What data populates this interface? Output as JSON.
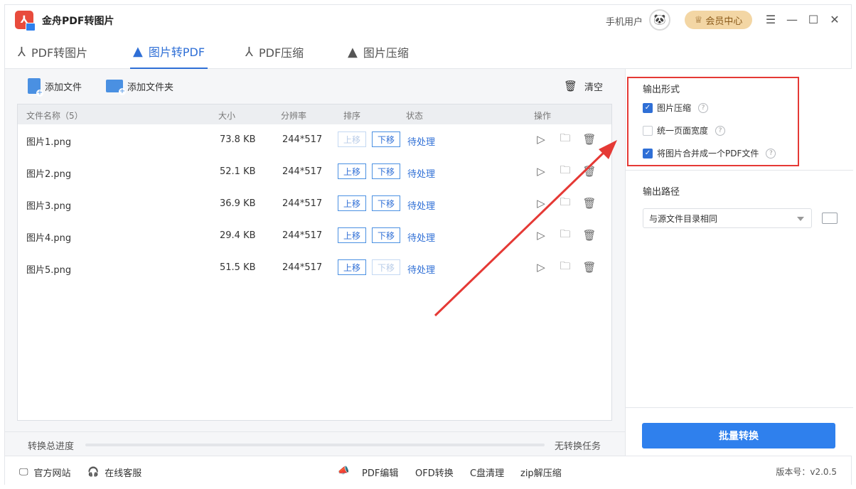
{
  "app": {
    "title": "金舟PDF转图片",
    "user_name": "手机用户",
    "vip_label": "会员中心"
  },
  "tabs": [
    {
      "label": "PDF转图片",
      "active": false
    },
    {
      "label": "图片转PDF",
      "active": true
    },
    {
      "label": "PDF压缩",
      "active": false
    },
    {
      "label": "图片压缩",
      "active": false
    }
  ],
  "toolbar": {
    "add_file": "添加文件",
    "add_folder": "添加文件夹",
    "clear": "清空"
  },
  "table": {
    "headers": {
      "name": "文件名称（5）",
      "size": "大小",
      "resolution": "分辨率",
      "order": "排序",
      "status": "状态",
      "actions": "操作"
    },
    "move_up": "上移",
    "move_down": "下移",
    "rows": [
      {
        "name": "图片1.png",
        "size": "73.8 KB",
        "resolution": "244*517",
        "status": "待处理",
        "up_enabled": false,
        "down_enabled": true
      },
      {
        "name": "图片2.png",
        "size": "52.1 KB",
        "resolution": "244*517",
        "status": "待处理",
        "up_enabled": true,
        "down_enabled": true
      },
      {
        "name": "图片3.png",
        "size": "36.9 KB",
        "resolution": "244*517",
        "status": "待处理",
        "up_enabled": true,
        "down_enabled": true
      },
      {
        "name": "图片4.png",
        "size": "29.4 KB",
        "resolution": "244*517",
        "status": "待处理",
        "up_enabled": true,
        "down_enabled": true
      },
      {
        "name": "图片5.png",
        "size": "51.5 KB",
        "resolution": "244*517",
        "status": "待处理",
        "up_enabled": true,
        "down_enabled": false
      }
    ]
  },
  "progress": {
    "label": "转换总进度",
    "value": 0,
    "status": "无转换任务"
  },
  "output_format": {
    "title": "输出形式",
    "options": [
      {
        "label": "图片压缩",
        "checked": true
      },
      {
        "label": "统一页面宽度",
        "checked": false
      },
      {
        "label": "将图片合并成一个PDF文件",
        "checked": true
      }
    ]
  },
  "output_path": {
    "title": "输出路径",
    "selected": "与源文件目录相同"
  },
  "batch_button": "批量转换",
  "footer": {
    "website": "官方网站",
    "support": "在线客服",
    "links": [
      "PDF编辑",
      "OFD转换",
      "C盘清理",
      "zip解压缩"
    ],
    "version": "版本号：v2.0.5"
  },
  "colors": {
    "accent": "#2f80ed",
    "annotation": "#e53935",
    "vip": "#f3d6a4"
  }
}
